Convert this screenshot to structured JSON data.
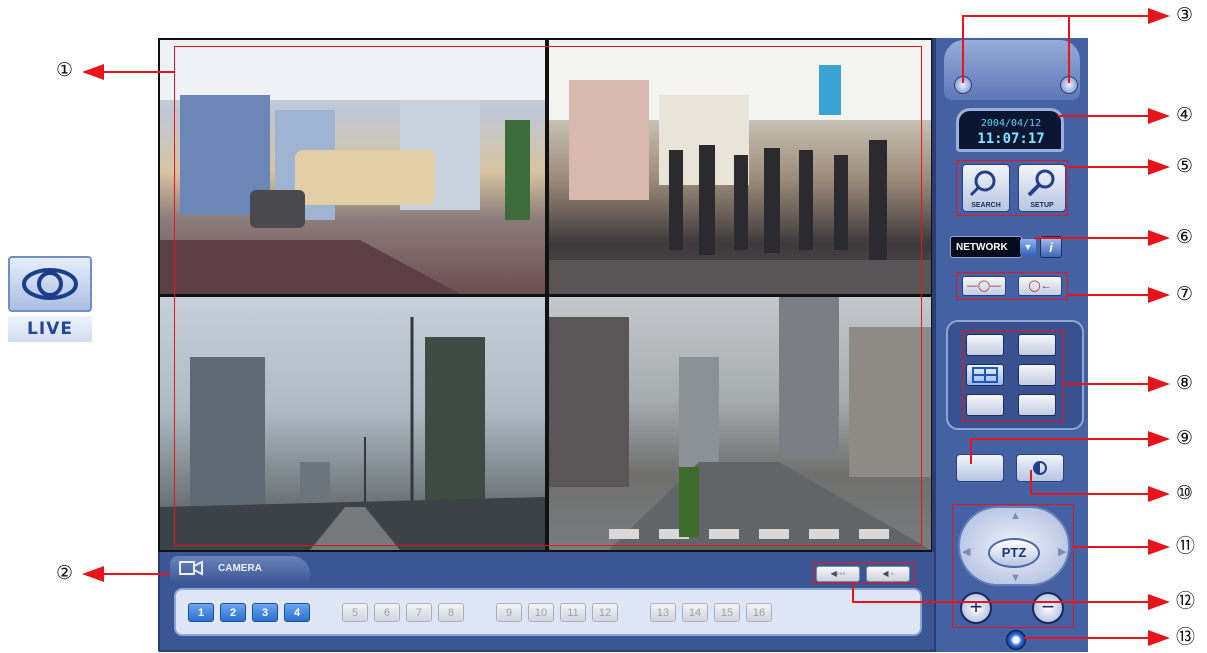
{
  "live": {
    "label": "LIVE",
    "icon": "eye-icon"
  },
  "camera_bar": {
    "tab_label": "CAMERA",
    "cameras": [
      {
        "label": "1",
        "active": true
      },
      {
        "label": "2",
        "active": true
      },
      {
        "label": "3",
        "active": true
      },
      {
        "label": "4",
        "active": true
      },
      {
        "label": "5",
        "active": false
      },
      {
        "label": "6",
        "active": false
      },
      {
        "label": "7",
        "active": false
      },
      {
        "label": "8",
        "active": false
      },
      {
        "label": "9",
        "active": false
      },
      {
        "label": "10",
        "active": false
      },
      {
        "label": "11",
        "active": false
      },
      {
        "label": "12",
        "active": false
      },
      {
        "label": "13",
        "active": false
      },
      {
        "label": "14",
        "active": false
      },
      {
        "label": "15",
        "active": false
      },
      {
        "label": "16",
        "active": false
      }
    ]
  },
  "panel": {
    "date": "2004/04/12",
    "time": "11:07:17",
    "search_label": "SEARCH",
    "setup_label": "SETUP",
    "network_value": "NETWORK",
    "info_label": "i",
    "ptz_label": "PTZ",
    "zoom_in_label": "+",
    "zoom_out_label": "−"
  },
  "callouts": [
    "①",
    "②",
    "③",
    "④",
    "⑤",
    "⑥",
    "⑦",
    "⑧",
    "⑨",
    "⑩",
    "⑪",
    "⑫",
    "⑬"
  ],
  "colors": {
    "annotation": "#e8141b",
    "panel": "#4461a3",
    "clock_text": "#7fe6ff"
  }
}
